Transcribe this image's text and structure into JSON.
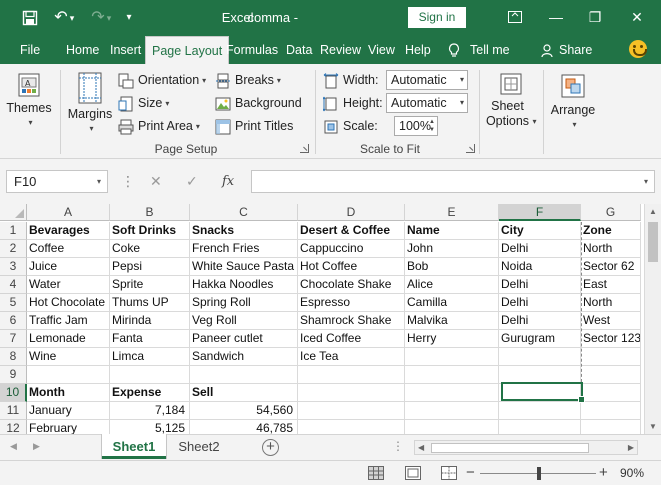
{
  "titlebar": {
    "title": "comma",
    "app": "Excel",
    "signin_label": "Sign in",
    "minimize_glyph": "—",
    "restore_glyph": "❐",
    "close_glyph": "✕",
    "save_glyph": "🖫",
    "undo_glyph": "↶",
    "redo_glyph": "↷",
    "caret_glyph": "▾"
  },
  "tabs": [
    "File",
    "Home",
    "Insert",
    "Page Layout",
    "Formulas",
    "Data",
    "Review",
    "View",
    "Help",
    "Tell me",
    "Share"
  ],
  "ribbon": {
    "themes": {
      "label": "Themes"
    },
    "margins": {
      "label": "Margins"
    },
    "orientation": {
      "label": "Orientation"
    },
    "size": {
      "label": "Size"
    },
    "print_area": {
      "label": "Print Area"
    },
    "breaks": {
      "label": "Breaks"
    },
    "background": {
      "label": "Background"
    },
    "print_titles": {
      "label": "Print Titles"
    },
    "page_setup_label": "Page Setup",
    "width": {
      "label": "Width:",
      "value": "Automatic"
    },
    "height": {
      "label": "Height:",
      "value": "Automatic"
    },
    "scale": {
      "label": "Scale:",
      "value": "100%"
    },
    "scale_to_fit_label": "Scale to Fit",
    "sheet_options": {
      "label": "Sheet Options"
    },
    "arrange": {
      "label": "Arrange"
    }
  },
  "formula_bar": {
    "name_box": "F10",
    "cancel_glyph": "✕",
    "enter_glyph": "✓",
    "fx_glyph": "fx",
    "formula": ""
  },
  "grid": {
    "columns": [
      "A",
      "B",
      "C",
      "D",
      "E",
      "F",
      "G"
    ],
    "rows": [
      "1",
      "2",
      "3",
      "4",
      "5",
      "6",
      "7",
      "8",
      "9",
      "10",
      "11",
      "12"
    ],
    "cells": [
      [
        "Bevarages",
        "Soft Drinks",
        "Snacks",
        "Desert & Coffee",
        "Name",
        "City",
        "Zone"
      ],
      [
        "Coffee",
        "Coke",
        "French Fries",
        "Cappuccino",
        "John",
        "Delhi",
        "North"
      ],
      [
        "Juice",
        "Pepsi",
        "White Sauce Pasta",
        "Hot Coffee",
        "Bob",
        "Noida",
        "Sector 62"
      ],
      [
        "Water",
        "Sprite",
        "Hakka Noodles",
        "Chocolate Shake",
        "Alice",
        "Delhi",
        "East"
      ],
      [
        "Hot Chocolate",
        "Thums UP",
        "Spring Roll",
        "Espresso",
        "Camilla",
        "Delhi",
        "North"
      ],
      [
        "Traffic Jam",
        "Mirinda",
        "Veg Roll",
        "Shamrock Shake",
        "Malvika",
        "Delhi",
        "West"
      ],
      [
        "Lemonade",
        "Fanta",
        "Paneer cutlet",
        "Iced Coffee",
        "Herry",
        "Gurugram",
        "Sector 123"
      ],
      [
        "Wine",
        "Limca",
        "Sandwich",
        "Ice Tea",
        "",
        "",
        ""
      ],
      [
        "",
        "",
        "",
        "",
        "",
        "",
        ""
      ],
      [
        "Month",
        "Expense",
        "Sell",
        "",
        "",
        "",
        ""
      ],
      [
        "January",
        "7,184",
        "54,560",
        "",
        "",
        "",
        ""
      ],
      [
        "February",
        "5,125",
        "46,785",
        "",
        "",
        "",
        ""
      ]
    ]
  },
  "sheets": [
    "Sheet1",
    "Sheet2"
  ],
  "statusbar": {
    "zoom": "90%",
    "minus": "−",
    "plus": "+"
  },
  "colors": {
    "accent": "#217346"
  }
}
